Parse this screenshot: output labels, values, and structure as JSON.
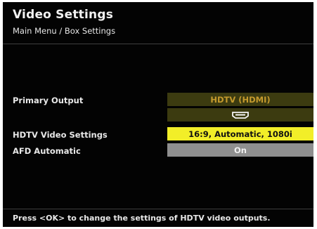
{
  "header": {
    "title": "Video Settings",
    "breadcrumb": "Main Menu / Box Settings"
  },
  "settings": [
    {
      "label": "Primary Output",
      "value": "HDTV (HDMI)"
    },
    {
      "label": "HDTV Video Settings",
      "value": "16:9, Automatic, 1080i"
    },
    {
      "label": "AFD Automatic",
      "value": "On"
    }
  ],
  "icons": {
    "output_connector": "hdmi-connector-icon"
  },
  "colors": {
    "background": "#030303",
    "selected_row": "#f2ee28",
    "primary_output_cell": "#3c3b10",
    "primary_output_text": "#c59a2d",
    "afd_cell": "#8f8f8f"
  },
  "footer": {
    "hint": "Press <OK> to change the settings of HDTV video outputs."
  }
}
